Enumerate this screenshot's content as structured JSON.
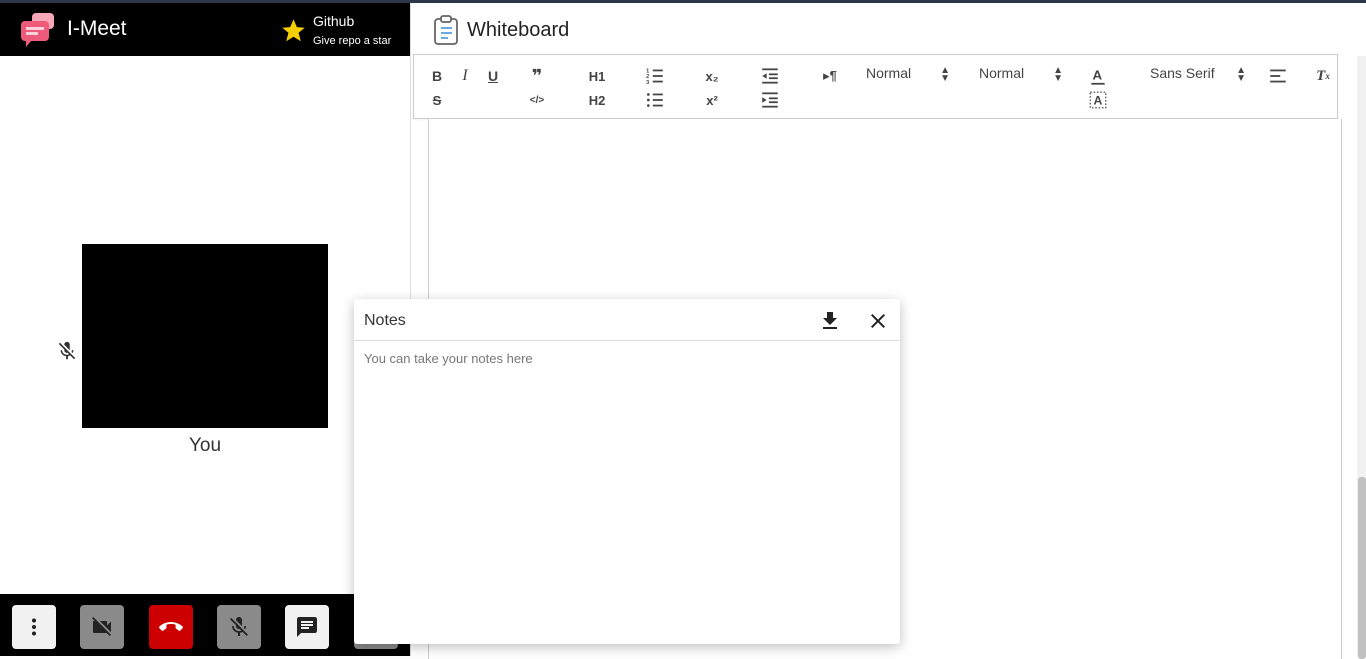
{
  "app": {
    "name": "I-Meet"
  },
  "github": {
    "title": "Github",
    "subtitle": "Give repo a star"
  },
  "participant": {
    "label": "You"
  },
  "whiteboard": {
    "title": "Whiteboard",
    "toolbar": {
      "h1": "H1",
      "h2": "H2",
      "size_select": "Normal",
      "header_select": "Normal",
      "font_select": "Sans Serif"
    }
  },
  "notes": {
    "title": "Notes",
    "placeholder": "You can take your notes here"
  },
  "colors": {
    "end_call": "#cc0000",
    "star": "#f5d000",
    "bar": "#000000"
  }
}
